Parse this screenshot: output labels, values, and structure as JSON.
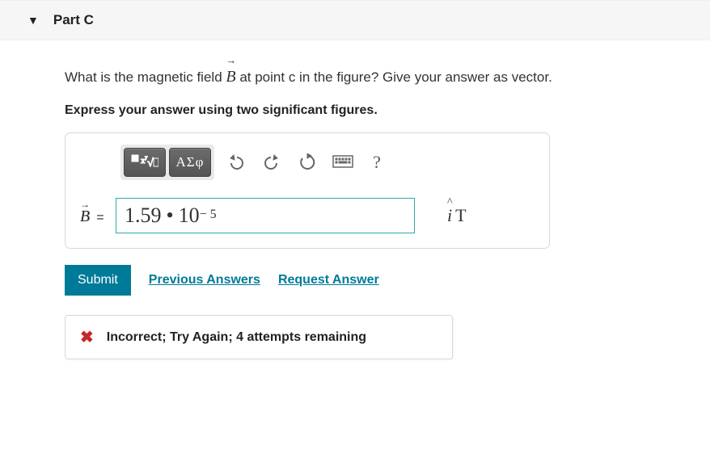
{
  "header": {
    "part_label": "Part C"
  },
  "question": {
    "prefix": "What is the magnetic field ",
    "vector_symbol": "B",
    "suffix": " at point c in the figure? Give your answer as vector.",
    "instruction": "Express your answer using two significant figures."
  },
  "toolbar": {
    "template_btn_title": "templates",
    "greek_btn_label": "ΑΣφ",
    "undo_title": "undo",
    "redo_title": "redo",
    "reset_title": "reset",
    "keyboard_title": "keyboard",
    "help_label": "?"
  },
  "answer": {
    "lhs_symbol": "B",
    "equals": "=",
    "value_mantissa": "1.59",
    "value_sep": "•",
    "value_base": "10",
    "value_exp": "− 5",
    "unit_prefix": "i",
    "unit": "T"
  },
  "actions": {
    "submit": "Submit",
    "previous": "Previous Answers",
    "request": "Request Answer"
  },
  "feedback": {
    "icon": "✖",
    "message": "Incorrect; Try Again; 4 attempts remaining"
  }
}
